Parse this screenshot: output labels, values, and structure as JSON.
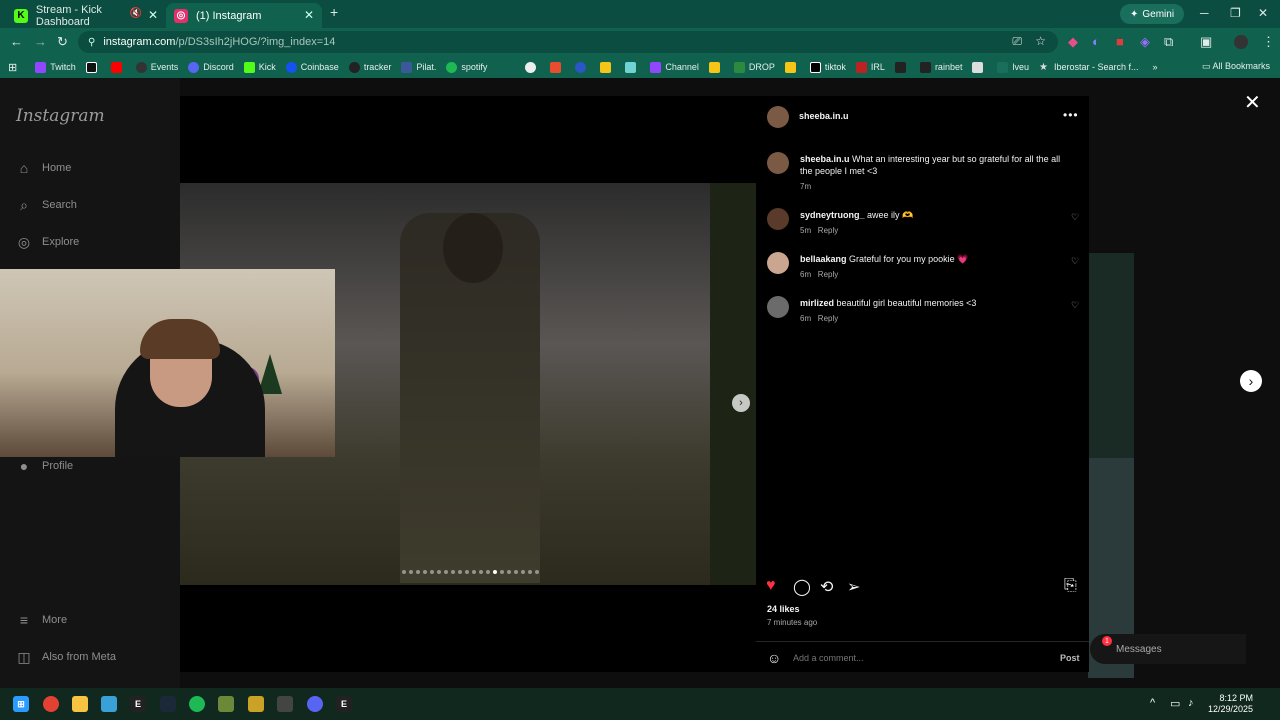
{
  "browser": {
    "tabs": [
      {
        "title": "Stream - Kick Dashboard",
        "favicon": "K",
        "color": "#53fc18"
      },
      {
        "title": "(1) Instagram",
        "favicon": "ig",
        "color": "#e1306c"
      }
    ],
    "gemini_label": "Gemini",
    "url_host": "instagram.com",
    "url_path": "/p/DS3sIh2jHOG/?img_index=14",
    "bookmarks": [
      "Twitch",
      "Events",
      "Discord",
      "Kick",
      "Coinbase",
      "tracker",
      "Pilat.",
      "spotify",
      "Channel",
      "DROP",
      "tiktok",
      "IRL",
      "rainbet",
      "lveu",
      "Iberostar - Search f..."
    ],
    "all_bookmarks": "All Bookmarks"
  },
  "instagram": {
    "logo": "Instagram",
    "nav": [
      {
        "label": "Home",
        "icon": "⌂"
      },
      {
        "label": "Search",
        "icon": "⌕"
      },
      {
        "label": "Explore",
        "icon": "◎"
      },
      {
        "label": "Profile",
        "icon": "●"
      },
      {
        "label": "More",
        "icon": "≡"
      },
      {
        "label": "Also from Meta",
        "icon": "◫"
      }
    ],
    "messages_label": "Messages",
    "messages_badge": "1"
  },
  "post": {
    "username": "sheeba.in.u",
    "caption": {
      "user": "sheeba.in.u",
      "text": "What an interesting year but so grateful for all the all the people I met <3",
      "time": "7m"
    },
    "comments": [
      {
        "user": "sydneytruong_",
        "text": "awee ily 🫶",
        "time": "5m",
        "reply": "Reply"
      },
      {
        "user": "bellaakang",
        "text": "Grateful for you my pookie 💗",
        "time": "6m",
        "reply": "Reply"
      },
      {
        "user": "mirlized",
        "text": "beautiful girl beautiful memories <3",
        "time": "6m",
        "reply": "Reply"
      }
    ],
    "likes": "24 likes",
    "posted_ago": "7 minutes ago",
    "comment_placeholder": "Add a comment...",
    "post_button": "Post",
    "image_index": 14,
    "image_count": 20
  },
  "taskbar": {
    "time": "8:12 PM",
    "date": "12/29/2025"
  },
  "colors": {
    "chrome_tabstrip": "#0b4d40",
    "chrome_toolbar": "#11614f",
    "like_red": "#ff3040"
  }
}
